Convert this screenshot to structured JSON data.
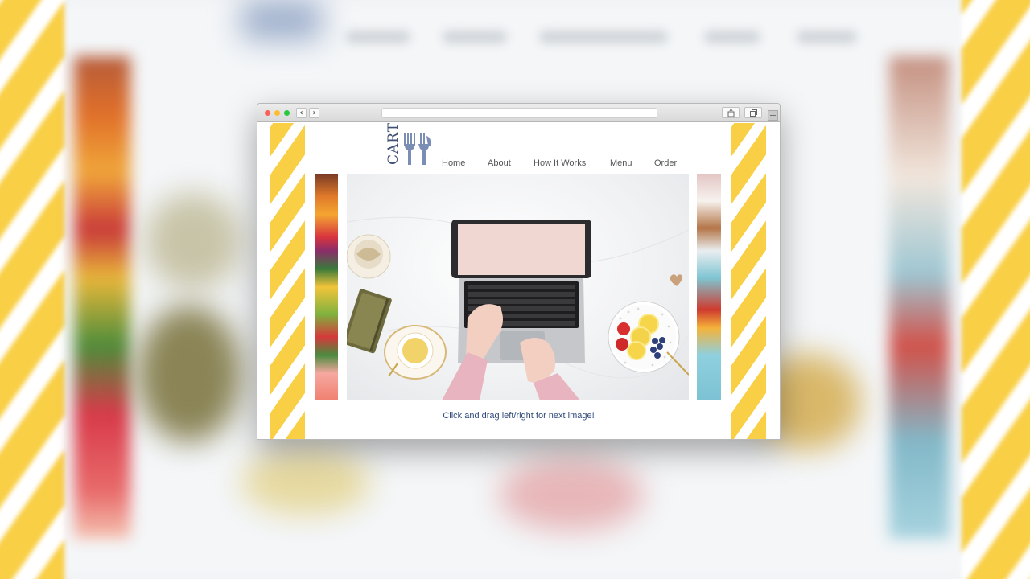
{
  "browser": {
    "nav_back": "‹",
    "nav_forward": "›",
    "new_tab": "+",
    "address_value": ""
  },
  "logo": {
    "text": "CART"
  },
  "nav": {
    "items": [
      {
        "label": "Home"
      },
      {
        "label": "About"
      },
      {
        "label": "How It Works"
      },
      {
        "label": "Menu"
      },
      {
        "label": "Order"
      }
    ]
  },
  "carousel": {
    "caption": "Click and drag left/right for next image!"
  },
  "colors": {
    "accent_yellow": "#f9cf46",
    "brand_navy": "#3e4f72",
    "caption_blue": "#2f4a7a"
  }
}
